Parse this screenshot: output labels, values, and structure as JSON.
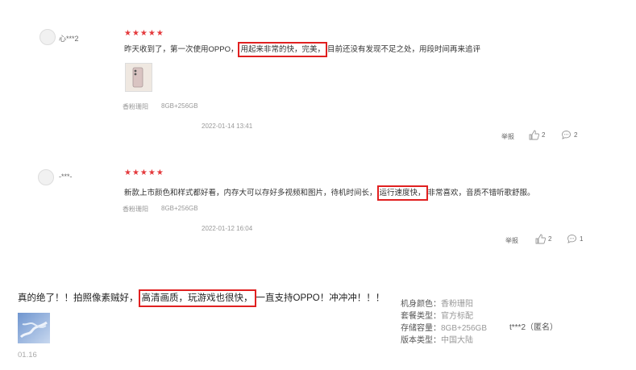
{
  "reviews": [
    {
      "user": "心***2",
      "stars": "★★★★★",
      "text_before": "昨天收到了，第一次使用OPPO，",
      "text_highlight": "用起来非常的快，完美，",
      "text_after": "目前还没有发现不足之处，用段时间再来追评",
      "spec_color": "香粉珊阳",
      "spec_storage": "8GB+256GB",
      "date": "2022-01-14 13:41",
      "report": "举报",
      "likes": "2",
      "comments": "2"
    },
    {
      "user": "-***-",
      "stars": "★★★★★",
      "text_before": "新款上市颜色和样式都好看，内存大可以存好多视频和图片，待机时间长，",
      "text_highlight": "运行速度快，",
      "text_after": "非常喜欢，音质不错听歌舒服。",
      "spec_color": "香粉珊阳",
      "spec_storage": "8GB+256GB",
      "date": "2022-01-12 16:04",
      "report": "举报",
      "likes": "2",
      "comments": "1"
    }
  ],
  "bottom": {
    "text_before": "真的绝了！！拍照像素贼好，",
    "text_highlight": "高清画质，玩游戏也很快，",
    "text_after": "一直支持OPPO！冲冲冲！！！",
    "date": "01.16",
    "specs": [
      {
        "label": "机身颜色：",
        "value": "香粉珊阳"
      },
      {
        "label": "套餐类型：",
        "value": "官方标配"
      },
      {
        "label": "存储容量：",
        "value": "8GB+256GB"
      },
      {
        "label": "版本类型：",
        "value": "中国大陆"
      }
    ],
    "user": "t***2（匿名）"
  },
  "colors": {
    "star": "#e4393c",
    "highlight_border": "#e02020"
  }
}
